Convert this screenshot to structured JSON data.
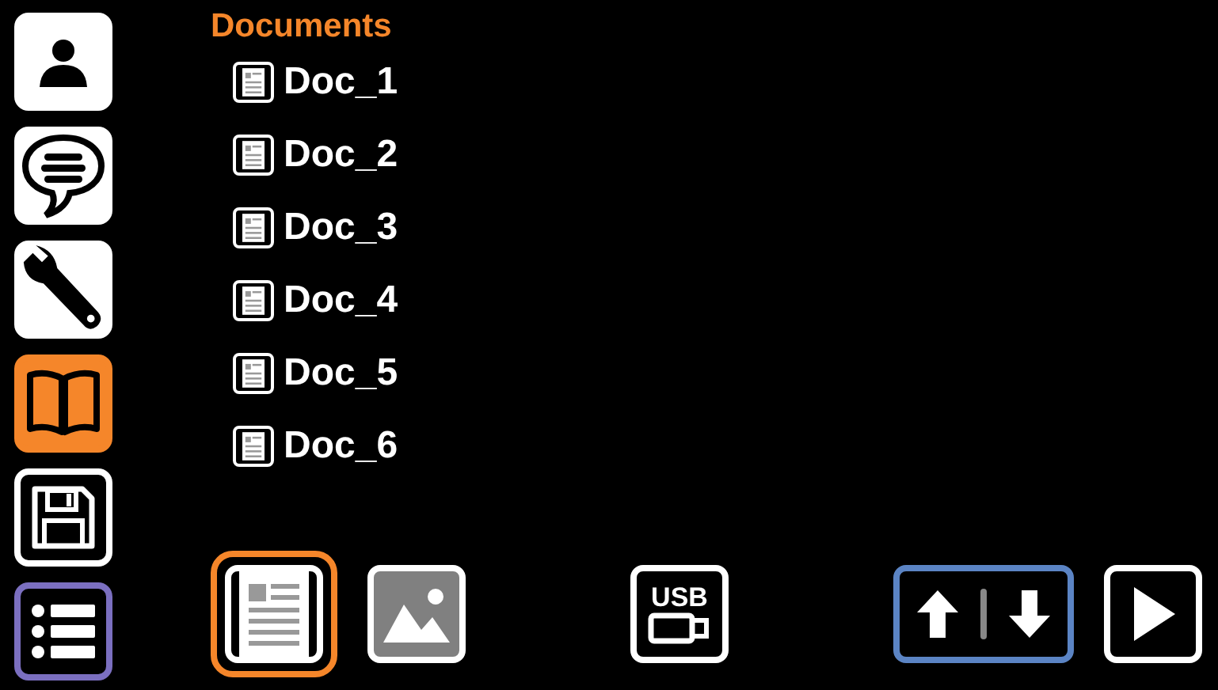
{
  "sidebar": {
    "items": [
      {
        "kind": "person",
        "selected": false,
        "focused": false
      },
      {
        "kind": "chat",
        "selected": false,
        "focused": false
      },
      {
        "kind": "wrench",
        "selected": false,
        "focused": false
      },
      {
        "kind": "book",
        "selected": true,
        "focused": false
      },
      {
        "kind": "save",
        "selected": false,
        "focused": false
      },
      {
        "kind": "list",
        "selected": false,
        "focused": true
      }
    ]
  },
  "title": "Documents",
  "documents": [
    {
      "name": "Doc_1"
    },
    {
      "name": "Doc_2"
    },
    {
      "name": "Doc_3"
    },
    {
      "name": "Doc_4"
    },
    {
      "name": "Doc_5"
    },
    {
      "name": "Doc_6"
    }
  ],
  "toolbar": {
    "filters": [
      {
        "kind": "document",
        "selected": true
      },
      {
        "kind": "image",
        "selected": false
      }
    ],
    "usb": {
      "label": "USB"
    },
    "scroll": {
      "focused": true
    },
    "play": {
      "focused": false
    }
  }
}
